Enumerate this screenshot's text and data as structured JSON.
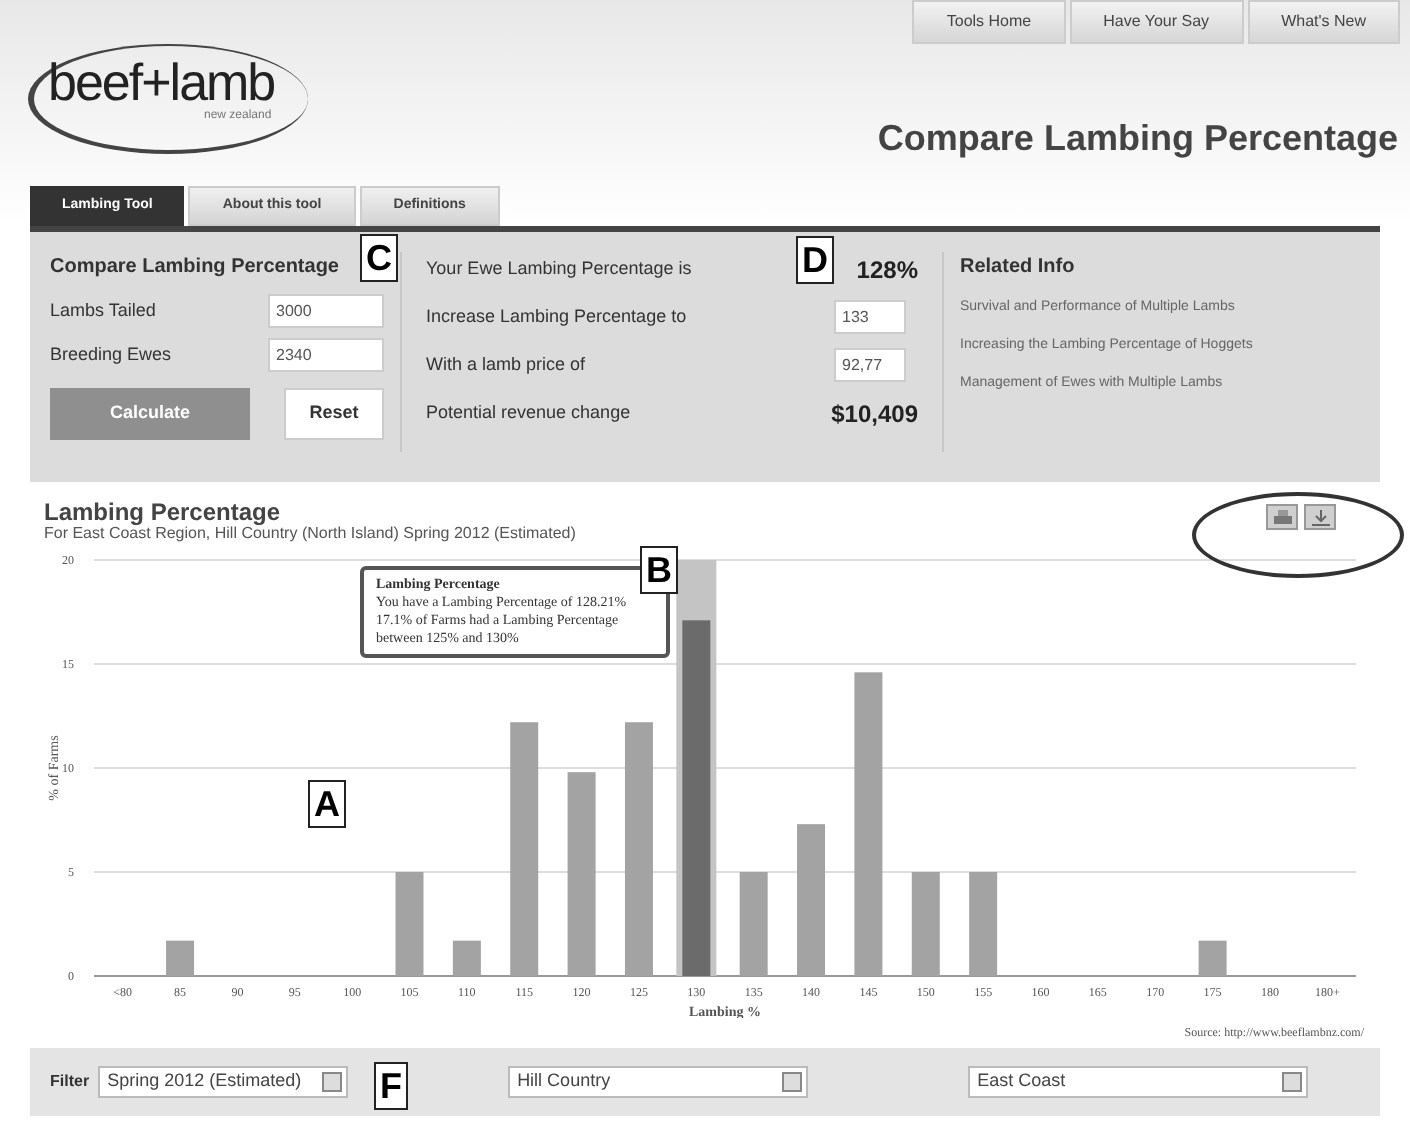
{
  "top_nav": [
    {
      "label": "Tools Home"
    },
    {
      "label": "Have Your Say"
    },
    {
      "label": "What's New"
    }
  ],
  "logo": {
    "text": "beef+lamb",
    "subtext": "new zealand"
  },
  "page_title": "Compare Lambing Percentage",
  "tabs": [
    {
      "label": "Lambing Tool",
      "selected": true
    },
    {
      "label": "About this tool",
      "selected": false
    },
    {
      "label": "Definitions",
      "selected": false
    }
  ],
  "calculator": {
    "title": "Compare Lambing Percentage",
    "fields": [
      {
        "label": "Lambs Tailed",
        "value": "3000"
      },
      {
        "label": "Breeding Ewes",
        "value": "2340"
      }
    ],
    "buttons": [
      {
        "label": "Calculate",
        "kind": "primary",
        "disabled": true
      },
      {
        "label": "Reset",
        "kind": "secondary",
        "disabled": false
      }
    ]
  },
  "results": [
    {
      "label": "Your Ewe Lambing Percentage is",
      "kind": "value",
      "value": "128%"
    },
    {
      "label": "Increase Lambing Percentage to",
      "kind": "input",
      "value": "133"
    },
    {
      "label": "With a lamb price of",
      "kind": "input",
      "value": "92,77"
    },
    {
      "label": "Potential revenue change",
      "kind": "value",
      "value": "$10,409"
    }
  ],
  "related_info": {
    "title": "Related Info",
    "links": [
      "Survival and Performance of Multiple Lambs",
      "Increasing the Lambing Percentage of Hoggets",
      "Management of Ewes with Multiple Lambs"
    ]
  },
  "chart": {
    "title": "Lambing Percentage",
    "subtitle": "For East Coast Region, Hill Country (North Island) Spring 2012 (Estimated)",
    "chart_data": {
      "type": "bar",
      "xlabel": "Lambing %",
      "ylabel": "% of Farms",
      "stacked": true,
      "categories": [
        "<80",
        "85",
        "90",
        "95",
        "100",
        "105",
        "110",
        "115",
        "120",
        "125",
        "130",
        "135",
        "140",
        "145",
        "150",
        "155",
        "160",
        "165",
        "170",
        "175",
        "180",
        "180+"
      ],
      "series": [
        {
          "color": "#a3a3a3",
          "values": [
            0,
            1.7,
            0,
            0,
            0,
            5,
            1.7,
            12.2,
            9.8,
            12.2,
            null,
            5,
            7.3,
            14.6,
            5,
            5,
            0,
            0,
            0,
            1.7,
            0,
            0
          ]
        },
        {
          "color": "#6b6b6b",
          "values": [
            null,
            null,
            null,
            null,
            null,
            null,
            null,
            null,
            null,
            null,
            17.1,
            null,
            null,
            null,
            null,
            null,
            null,
            null,
            null,
            null,
            null,
            null
          ]
        }
      ],
      "ylim": [
        0,
        20
      ],
      "yticks": [
        0,
        5,
        10,
        15,
        20
      ],
      "grid": true
    },
    "tooltip": {
      "title": "Lambing Percentage",
      "lines": [
        "You have a Lambing Percentage of 128.21%",
        "17.1% of Farms had a Lambing Percentage",
        "between 125% and 130%"
      ]
    },
    "source": "Source: http://www.beeflambnz.com/"
  },
  "filter": {
    "label": "Filter",
    "selects": [
      {
        "value": "Spring 2012 (Estimated)"
      },
      {
        "value": "Hill Country"
      },
      {
        "value": "East Coast"
      }
    ]
  },
  "annotations": [
    {
      "label": "C"
    },
    {
      "label": "D"
    },
    {
      "label": "B"
    },
    {
      "label": "A"
    },
    {
      "label": "F"
    }
  ]
}
